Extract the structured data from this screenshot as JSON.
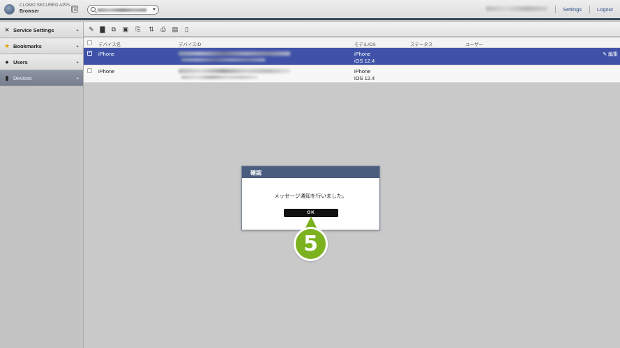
{
  "header": {
    "app_name_line1": "CLOMO SECURED APPs",
    "app_name_line2": "Browser",
    "settings_label": "Settings",
    "logout_label": "Logout"
  },
  "sidebar": {
    "items": [
      {
        "label": "Service Settings",
        "icon": "wrench-icon"
      },
      {
        "label": "Bookmarks",
        "icon": "star-icon"
      },
      {
        "label": "Users",
        "icon": "user-icon"
      },
      {
        "label": "Devices",
        "icon": "device-icon"
      }
    ]
  },
  "table": {
    "columns": [
      "デバイス名",
      "デバイスID",
      "モデル/OS",
      "ステータス",
      "ユーザー"
    ],
    "rows": [
      {
        "name": "iPhone",
        "model": "iPhone",
        "os": "iOS 12.4",
        "edit": "✎ 編集",
        "selected": true
      },
      {
        "name": "iPhone",
        "model": "iPhone",
        "os": "iOS 12.4",
        "selected": false
      }
    ]
  },
  "dialog": {
    "title": "確認",
    "message": "メッセージ通知を行いました。",
    "ok_label": "OK"
  },
  "callout": {
    "number": "5",
    "color": "#7cb21f"
  },
  "colors": {
    "selected_row": "#3f52a8",
    "dialog_header": "#4a5d7e",
    "topbar_border": "#3c4a5c"
  }
}
